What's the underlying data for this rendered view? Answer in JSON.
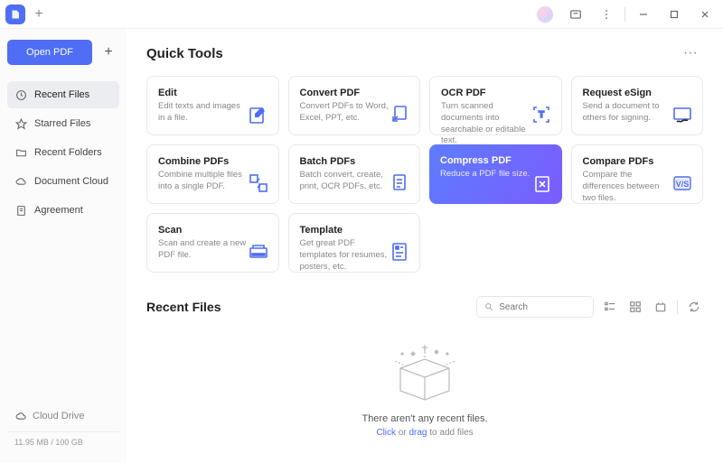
{
  "titlebar": {
    "new_tab_label": "+"
  },
  "sidebar": {
    "open_label": "Open PDF",
    "items": [
      {
        "label": "Recent Files"
      },
      {
        "label": "Starred Files"
      },
      {
        "label": "Recent Folders"
      },
      {
        "label": "Document Cloud"
      },
      {
        "label": "Agreement"
      }
    ],
    "cloud_drive": "Cloud Drive",
    "storage": "11.95 MB / 100 GB"
  },
  "quick_tools": {
    "title": "Quick Tools",
    "more": "···",
    "cards": [
      {
        "title": "Edit",
        "desc": "Edit texts and images in a file."
      },
      {
        "title": "Convert PDF",
        "desc": "Convert PDFs to Word, Excel, PPT, etc."
      },
      {
        "title": "OCR PDF",
        "desc": "Turn scanned documents into searchable or editable text."
      },
      {
        "title": "Request eSign",
        "desc": "Send a document to others for signing."
      },
      {
        "title": "Combine PDFs",
        "desc": "Combine multiple files into a single PDF."
      },
      {
        "title": "Batch PDFs",
        "desc": "Batch convert, create, print, OCR PDFs, etc."
      },
      {
        "title": "Compress PDF",
        "desc": "Reduce a PDF file size."
      },
      {
        "title": "Compare PDFs",
        "desc": "Compare the differences between two files."
      },
      {
        "title": "Scan",
        "desc": "Scan and create a new PDF file."
      },
      {
        "title": "Template",
        "desc": "Get great PDF templates for resumes, posters, etc."
      }
    ]
  },
  "recent": {
    "title": "Recent Files",
    "search_placeholder": "Search",
    "empty_text": "There aren't any recent files.",
    "empty_click": "Click",
    "empty_or": " or ",
    "empty_drag": "drag",
    "empty_suffix": " to add files"
  }
}
